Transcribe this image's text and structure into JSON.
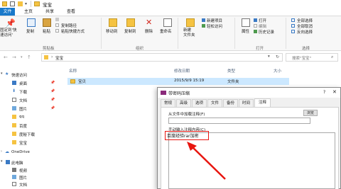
{
  "window": {
    "title": "宝宝"
  },
  "ribbon_tabs": {
    "file": "文件",
    "home": "主页",
    "share": "共享",
    "view": "查看"
  },
  "ribbon": {
    "pin_quick_access": "固定到'快\n速访问'",
    "copy": "复制",
    "paste": "粘贴",
    "copy_path": "复制路径",
    "paste_shortcut": "粘贴快捷方式",
    "clipboard_group": "剪贴板",
    "move_to": "移动到",
    "copy_to": "复制到",
    "delete": "删除",
    "rename": "重命名",
    "organize_group": "组织",
    "new_item": "新建项目",
    "easy_access": "轻松访问",
    "new_folder": "新建\n文件夹",
    "properties": "属性",
    "open": "打开",
    "edit": "编辑",
    "history": "历史记录",
    "open_group": "打开",
    "select_all": "全部选择",
    "select_none": "全部取消",
    "invert_selection": "反向选择",
    "select_group": "选择"
  },
  "address": {
    "path": "宝宝",
    "search_placeholder": "搜索\"宝宝\""
  },
  "nav_pane": {
    "items": [
      {
        "label": "快速访问"
      },
      {
        "label": "桌面"
      },
      {
        "label": "下载"
      },
      {
        "label": "文档"
      },
      {
        "label": "图片"
      },
      {
        "label": "qq"
      },
      {
        "label": "百度"
      },
      {
        "label": "度秘下载"
      },
      {
        "label": "宝宝"
      },
      {
        "label": "OneDrive"
      },
      {
        "label": "此电脑"
      },
      {
        "label": "视频"
      },
      {
        "label": "图片"
      },
      {
        "label": "文档"
      }
    ]
  },
  "file_list": {
    "columns": {
      "name": "名称",
      "date": "修改日期",
      "type": "类型",
      "size": "大小"
    },
    "rows": [
      {
        "name": "宝贝",
        "date": "2015/9/9 15:19",
        "type": "文件夹"
      }
    ]
  },
  "dialog": {
    "title": "带密码压缩",
    "help": "?",
    "tabs": [
      "常规",
      "高级",
      "选项",
      "文件",
      "备份",
      "时间",
      "注释"
    ],
    "active_tab": "注释",
    "load_label": "从文件中加载注释(F)",
    "browse_button": "浏览",
    "manual_label": "手动输入注释内容(C)",
    "comment_value": "百度经验rar加密"
  },
  "colors": {
    "accent": "#1979ca",
    "selection": "#cce8ff",
    "highlight": "#e8150f"
  }
}
